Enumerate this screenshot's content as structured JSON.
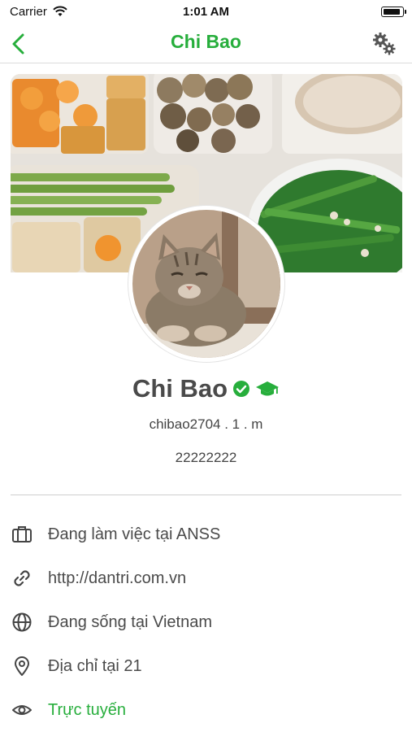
{
  "status_bar": {
    "carrier": "Carrier",
    "time": "1:01 AM"
  },
  "nav": {
    "title": "Chi Bao",
    "back_icon": "chevron-left-icon",
    "settings_icon": "gears-icon"
  },
  "profile": {
    "name": "Chi Bao",
    "username": "chibao2704 . 1 . m",
    "phone": "22222222"
  },
  "info": [
    {
      "icon": "briefcase-icon",
      "text": "Đang làm việc tại ANSS"
    },
    {
      "icon": "link-icon",
      "text": "http://dantri.com.vn"
    },
    {
      "icon": "globe-icon",
      "text": "Đang sống tại Vietnam"
    },
    {
      "icon": "location-pin-icon",
      "text": "Địa chỉ tại 21"
    },
    {
      "icon": "eye-icon",
      "text": "Trực tuyến"
    }
  ],
  "colors": {
    "accent": "#27ae3c",
    "text": "#4a4a4a"
  }
}
